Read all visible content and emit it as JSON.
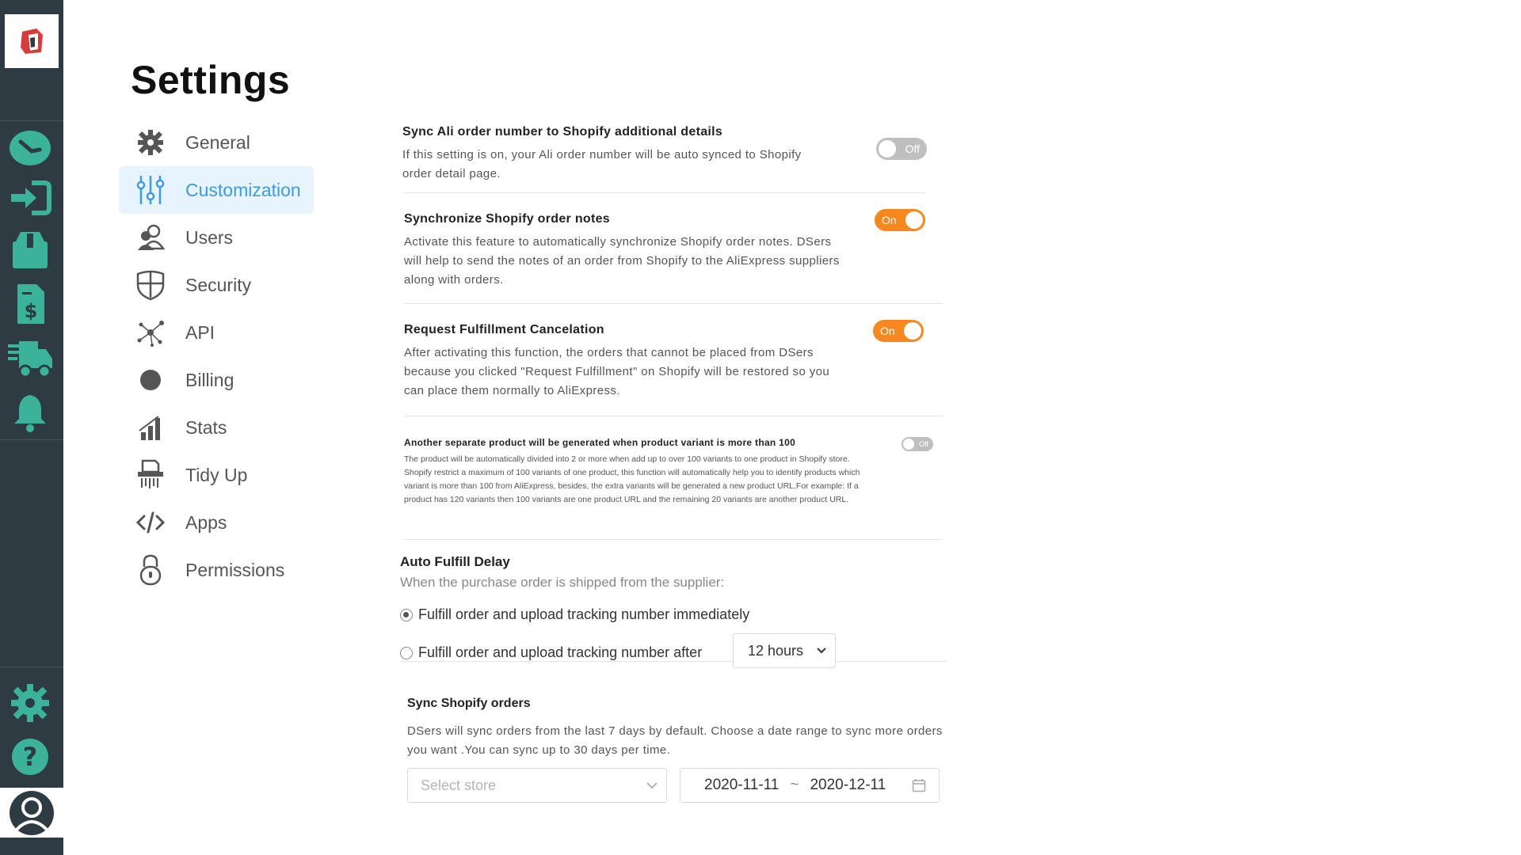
{
  "page": {
    "title": "Settings"
  },
  "rail": {
    "icons": [
      "dashboard-icon",
      "import-icon",
      "box-icon",
      "invoice-icon",
      "shipping-truck-icon",
      "bell-icon",
      "gear-icon",
      "help-icon",
      "user-avatar-icon"
    ],
    "background": "#2f3b42",
    "accent": "#3bb39b"
  },
  "nav": {
    "items": [
      {
        "label": "General",
        "icon": "gear-icon"
      },
      {
        "label": "Customization",
        "icon": "sliders-icon",
        "active": true
      },
      {
        "label": "Users",
        "icon": "users-icon"
      },
      {
        "label": "Security",
        "icon": "shield-icon"
      },
      {
        "label": "API",
        "icon": "network-icon"
      },
      {
        "label": "Billing",
        "icon": "billing-icon"
      },
      {
        "label": "Stats",
        "icon": "stats-icon"
      },
      {
        "label": "Tidy Up",
        "icon": "shredder-icon"
      },
      {
        "label": "Apps",
        "icon": "code-icon"
      },
      {
        "label": "Permissions",
        "icon": "lock-icon"
      }
    ]
  },
  "settings": [
    {
      "title": "Sync Ali order number to Shopify additional details",
      "desc": "If this setting is on, your Ali order number will be auto synced to Shopify order detail page.",
      "toggle": "Off"
    },
    {
      "title": "Synchronize Shopify order notes",
      "desc": "Activate this feature to automatically synchronize Shopify order notes. DSers will help to send the notes of an order from Shopify to the AliExpress suppliers along with orders.",
      "toggle": "On"
    },
    {
      "title": "Request Fulfillment Cancelation",
      "desc": "After activating this function, the orders that cannot be placed from DSers because you clicked \"Request Fulfillment\" on Shopify will be restored so you can place them normally to AliExpress.",
      "toggle": "On"
    },
    {
      "title": "Another separate product will be generated when product variant is more than 100",
      "desc": "The product will be automatically divided into 2 or more when add up to over 100 variants to one product in Shopify store. Shopify restrict a maximum of 100 variants of one product, this function will automatically help you to identify products which variant is more than 100 from AliExpress, besides, the extra variants will be generated a new product URL.For example: If a product has 120 variants then 100 variants are one product URL and the remaining 20 variants are another product URL.",
      "toggle": "Off"
    }
  ],
  "auto_fulfill": {
    "title": "Auto Fulfill Delay",
    "subtitle": "When the purchase order is shipped from the supplier:",
    "option_immediately": "Fulfill order and upload tracking number immediately",
    "option_after": "Fulfill order and upload tracking number after",
    "delay_value": "12 hours"
  },
  "sync_orders": {
    "title": "Sync Shopify orders",
    "desc": "DSers will sync orders from the last 7 days by default. Choose a date range to sync more orders you want .You can sync up to 30 days per time.",
    "store_placeholder": "Select store",
    "date_from": "2020-11-11",
    "date_sep": "~",
    "date_to": "2020-12-11"
  },
  "colors": {
    "toggle_on": "#f7881f",
    "toggle_off": "#bfbfbf",
    "active_nav": "#3a9be6"
  }
}
